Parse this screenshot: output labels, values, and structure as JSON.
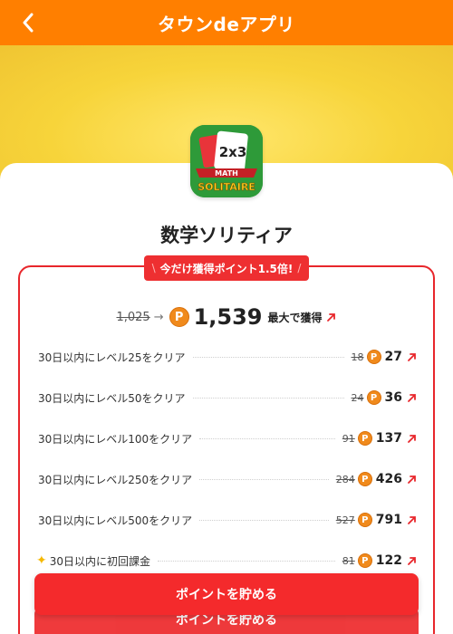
{
  "header": {
    "title": "タウンdeアプリ",
    "back_icon": "chevron-left-icon"
  },
  "app": {
    "name": "数学ソリティア",
    "icon_text_top": "2x3",
    "icon_text_math": "MATH",
    "icon_text_solitaire": "SOLITAIRE"
  },
  "promo": {
    "label": "今だけ獲得ポイント1.5倍!",
    "left_mark": "\\",
    "right_mark": "/"
  },
  "total": {
    "old_points": "1,025",
    "new_points": "1,539",
    "suffix": "最大で獲得",
    "coin_glyph": "P"
  },
  "tasks": [
    {
      "label": "30日以内にレベル25をクリア",
      "old": "18",
      "new": "27",
      "sparkle": false
    },
    {
      "label": "30日以内にレベル50をクリア",
      "old": "24",
      "new": "36",
      "sparkle": false
    },
    {
      "label": "30日以内にレベル100をクリア",
      "old": "91",
      "new": "137",
      "sparkle": false
    },
    {
      "label": "30日以内にレベル250をクリア",
      "old": "284",
      "new": "426",
      "sparkle": false
    },
    {
      "label": "30日以内にレベル500をクリア",
      "old": "527",
      "new": "791",
      "sparkle": false
    },
    {
      "label": "30日以内に初回課金",
      "old": "81",
      "new": "122",
      "sparkle": true
    }
  ],
  "buttons": {
    "save_points": "ポイントを貯める",
    "save_points_ghost": "ポイントを貯める"
  },
  "colors": {
    "header": "#ff7f00",
    "accent_red": "#ee2f31",
    "coin": "#f08a1c",
    "hero_yellow": "#f7d43a"
  }
}
